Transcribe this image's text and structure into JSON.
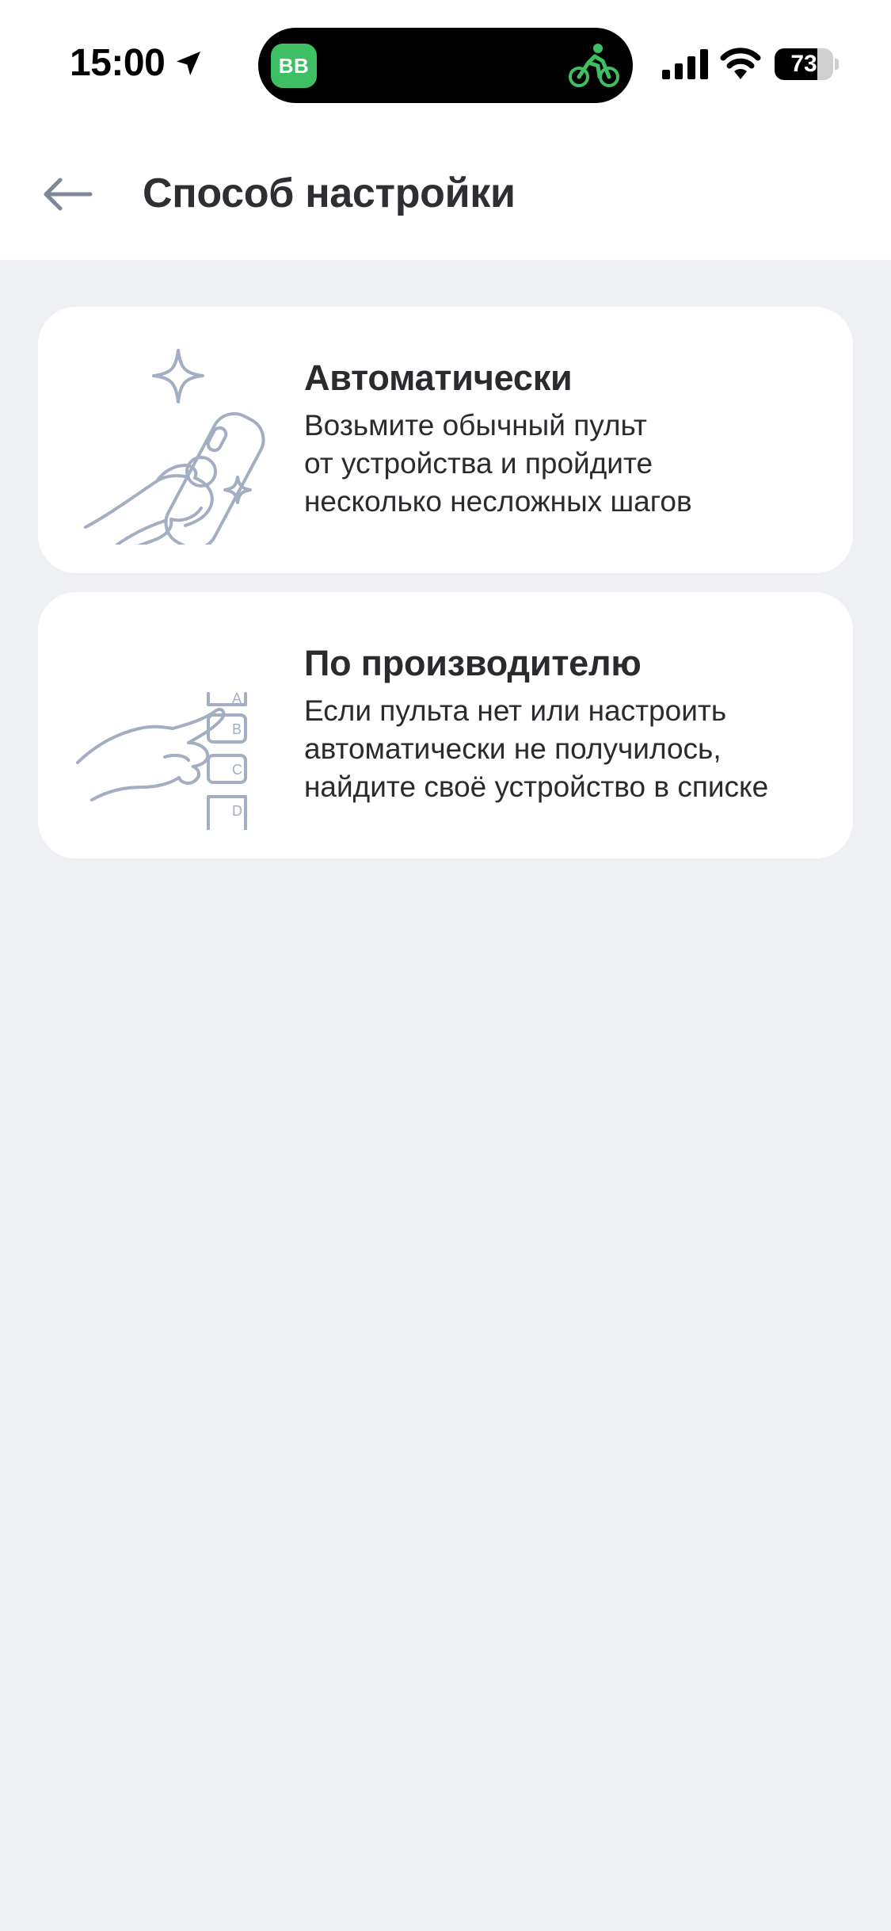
{
  "status_bar": {
    "time": "15:00",
    "island_app_label": "BB",
    "battery_level": "73",
    "battery_fraction": 0.73,
    "icons": [
      "location-arrow-icon",
      "bike-icon",
      "cellular-signal-icon",
      "wifi-icon",
      "battery-icon"
    ]
  },
  "header": {
    "title": "Способ настройки",
    "back_icon": "arrow-left-icon"
  },
  "options": [
    {
      "title": "Автоматически",
      "description_lines": [
        "Возьмите обычный пульт",
        "от устройства и пройдите",
        "несколько несложных шагов"
      ],
      "icon": "hand-remote-illustration"
    },
    {
      "title": "По производителю",
      "description_lines": [
        "Если пульта нет или настроить",
        "автоматически не получилось,",
        "найдите своё устройство в списке"
      ],
      "icon": "hand-list-illustration",
      "list_letters": [
        "A",
        "B",
        "C",
        "D"
      ]
    }
  ],
  "colors": {
    "background": "#eff0f3",
    "surface": "#ffffff",
    "text": "#2b2b2f",
    "illustration": "#a3aec2",
    "accent_green": "#3fbf63"
  }
}
